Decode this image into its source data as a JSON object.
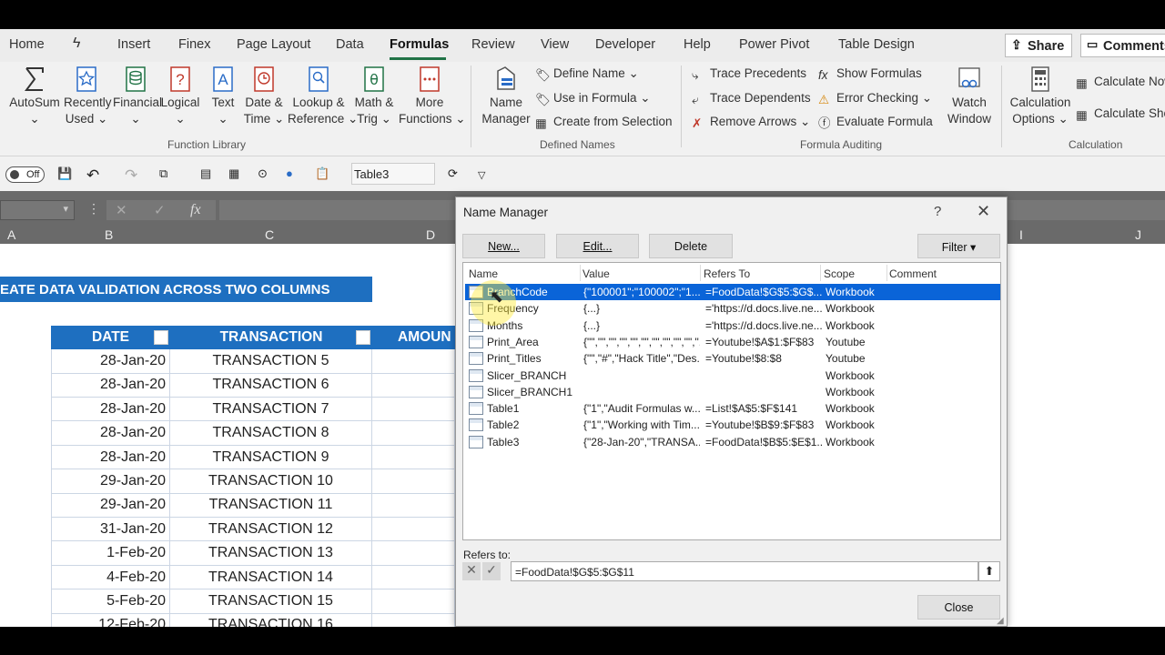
{
  "tabs": [
    "Home",
    "Finex",
    "Insert",
    "Page Layout",
    "Data",
    "Formulas",
    "Review",
    "View",
    "Developer",
    "Help",
    "Power Pivot",
    "Table Design"
  ],
  "share_label": "Share",
  "comments_label": "Comments",
  "ribbon": {
    "autosum": "AutoSum",
    "recently_used": [
      "Recently",
      "Used"
    ],
    "financial": "Financial",
    "logical": "Logical",
    "text": "Text",
    "date_time": [
      "Date &",
      "Time"
    ],
    "lookup": [
      "Lookup &",
      "Reference"
    ],
    "math": [
      "Math &",
      "Trig"
    ],
    "more_functions": [
      "More",
      "Functions"
    ],
    "function_library": "Function Library",
    "name_manager": [
      "Name",
      "Manager"
    ],
    "define_name": "Define Name",
    "use_in_formula": "Use in Formula",
    "create_from_selection": "Create from Selection",
    "defined_names": "Defined Names",
    "trace_precedents": "Trace Precedents",
    "trace_dependents": "Trace Dependents",
    "remove_arrows": "Remove Arrows",
    "show_formulas": "Show Formulas",
    "error_checking": "Error Checking",
    "evaluate_formula": "Evaluate Formula",
    "formula_auditing": "Formula Auditing",
    "watch_window": [
      "Watch",
      "Window"
    ],
    "calc_options": [
      "Calculation",
      "Options"
    ],
    "calculate_now": "Calculate Now",
    "calculate_sheet": "Calculate Sheet",
    "calculation": "Calculation"
  },
  "qat": {
    "autosave": "Off",
    "table_name": "Table3"
  },
  "formula_bar": {
    "fx": "fx"
  },
  "columns": [
    "A",
    "B",
    "C",
    "D",
    "I",
    "J"
  ],
  "sheet": {
    "banner": "EATE DATA VALIDATION ACROSS TWO COLUMNS",
    "headers": [
      "DATE",
      "TRANSACTION",
      "AMOUN"
    ],
    "rows": [
      [
        "28-Jan-20",
        "TRANSACTION 5"
      ],
      [
        "28-Jan-20",
        "TRANSACTION 6"
      ],
      [
        "28-Jan-20",
        "TRANSACTION 7"
      ],
      [
        "28-Jan-20",
        "TRANSACTION 8"
      ],
      [
        "28-Jan-20",
        "TRANSACTION 9"
      ],
      [
        "29-Jan-20",
        "TRANSACTION 10"
      ],
      [
        "29-Jan-20",
        "TRANSACTION 11"
      ],
      [
        "31-Jan-20",
        "TRANSACTION 12"
      ],
      [
        "1-Feb-20",
        "TRANSACTION 13"
      ],
      [
        "4-Feb-20",
        "TRANSACTION 14"
      ],
      [
        "5-Feb-20",
        "TRANSACTION 15"
      ],
      [
        "12-Feb-20",
        "TRANSACTION 16"
      ]
    ]
  },
  "dialog": {
    "title": "Name Manager",
    "help": "?",
    "close_x": "✕",
    "new": "New...",
    "edit": "Edit...",
    "delete": "Delete",
    "filter": "Filter ▾",
    "headers": [
      "Name",
      "Value",
      "Refers To",
      "Scope",
      "Comment"
    ],
    "rows": [
      [
        "BranchCode",
        "{\"100001\";\"100002\";\"1...",
        "=FoodData!$G$5:$G$...",
        "Workbook",
        ""
      ],
      [
        "Frequency",
        "{...}",
        "='https://d.docs.live.ne...",
        "Workbook",
        ""
      ],
      [
        "Months",
        "{...}",
        "='https://d.docs.live.ne...",
        "Workbook",
        ""
      ],
      [
        "Print_Area",
        "{\"\",\"\",\"\",\"\",\"\",\"\",\"\",\"\",\"\",\"\",\"...",
        "=Youtube!$A$1:$F$83",
        "Youtube",
        ""
      ],
      [
        "Print_Titles",
        "{\"\",\"#\",\"Hack Title\",\"Des...",
        "=Youtube!$8:$8",
        "Youtube",
        ""
      ],
      [
        "Slicer_BRANCH",
        "",
        "",
        "Workbook",
        ""
      ],
      [
        "Slicer_BRANCH1",
        "",
        "",
        "Workbook",
        ""
      ],
      [
        "Table1",
        "{\"1\",\"Audit Formulas w...",
        "=List!$A$5:$F$141",
        "Workbook",
        ""
      ],
      [
        "Table2",
        "{\"1\",\"Working with Tim...",
        "=Youtube!$B$9:$F$83",
        "Workbook",
        ""
      ],
      [
        "Table3",
        "{\"28-Jan-20\",\"TRANSA...",
        "=FoodData!$B$5:$E$1...",
        "Workbook",
        ""
      ]
    ],
    "refers_to_label": "Refers to:",
    "refers_to_value": "=FoodData!$G$5:$G$11",
    "close": "Close"
  }
}
